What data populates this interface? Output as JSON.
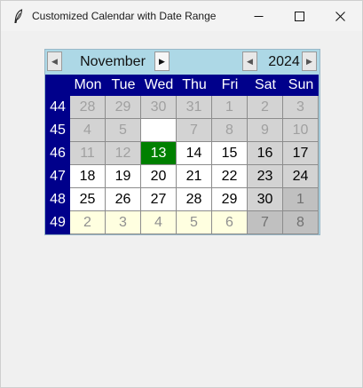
{
  "window": {
    "title": "Customized Calendar with Date Range"
  },
  "header": {
    "month": "November",
    "year": "2024",
    "prev_month_icon": "left-arrow",
    "next_month_icon": "right-arrow",
    "prev_year_icon": "left-arrow",
    "next_year_icon": "right-arrow"
  },
  "weekdays": [
    "Mon",
    "Tue",
    "Wed",
    "Thu",
    "Fri",
    "Sat",
    "Sun"
  ],
  "weeks": [
    {
      "num": "44",
      "days": [
        {
          "d": "28",
          "s": "disabled"
        },
        {
          "d": "29",
          "s": "disabled"
        },
        {
          "d": "30",
          "s": "disabled"
        },
        {
          "d": "31",
          "s": "disabled"
        },
        {
          "d": "1",
          "s": "disabled"
        },
        {
          "d": "2",
          "s": "disabled"
        },
        {
          "d": "3",
          "s": "disabled"
        }
      ]
    },
    {
      "num": "45",
      "days": [
        {
          "d": "4",
          "s": "disabled"
        },
        {
          "d": "5",
          "s": "disabled"
        },
        {
          "d": "",
          "s": "blank"
        },
        {
          "d": "7",
          "s": "disabled"
        },
        {
          "d": "8",
          "s": "disabled"
        },
        {
          "d": "9",
          "s": "disabled"
        },
        {
          "d": "10",
          "s": "disabled"
        }
      ]
    },
    {
      "num": "46",
      "days": [
        {
          "d": "11",
          "s": "disabled"
        },
        {
          "d": "12",
          "s": "disabled"
        },
        {
          "d": "13",
          "s": "selected"
        },
        {
          "d": "14",
          "s": "normal"
        },
        {
          "d": "15",
          "s": "normal"
        },
        {
          "d": "16",
          "s": "weekend"
        },
        {
          "d": "17",
          "s": "weekend"
        }
      ]
    },
    {
      "num": "47",
      "days": [
        {
          "d": "18",
          "s": "normal"
        },
        {
          "d": "19",
          "s": "normal"
        },
        {
          "d": "20",
          "s": "normal"
        },
        {
          "d": "21",
          "s": "normal"
        },
        {
          "d": "22",
          "s": "normal"
        },
        {
          "d": "23",
          "s": "weekend"
        },
        {
          "d": "24",
          "s": "weekend"
        }
      ]
    },
    {
      "num": "48",
      "days": [
        {
          "d": "25",
          "s": "normal"
        },
        {
          "d": "26",
          "s": "normal"
        },
        {
          "d": "27",
          "s": "normal"
        },
        {
          "d": "28",
          "s": "normal"
        },
        {
          "d": "29",
          "s": "normal"
        },
        {
          "d": "30",
          "s": "weekend"
        },
        {
          "d": "1",
          "s": "other-weekend"
        }
      ]
    },
    {
      "num": "49",
      "days": [
        {
          "d": "2",
          "s": "other"
        },
        {
          "d": "3",
          "s": "other"
        },
        {
          "d": "4",
          "s": "other"
        },
        {
          "d": "5",
          "s": "other"
        },
        {
          "d": "6",
          "s": "other"
        },
        {
          "d": "7",
          "s": "other-weekend"
        },
        {
          "d": "8",
          "s": "other-weekend"
        }
      ]
    }
  ],
  "colors": {
    "header_bg": "#add8e6",
    "weekday_bg": "#00008b",
    "selected_bg": "#008000",
    "disabled_bg": "#d3d3d3",
    "weekend_bg": "#d3d3d3",
    "other_bg": "#ffffe0",
    "other_weekend_bg": "#c0c0c0",
    "normal_bg": "#ffffff"
  }
}
